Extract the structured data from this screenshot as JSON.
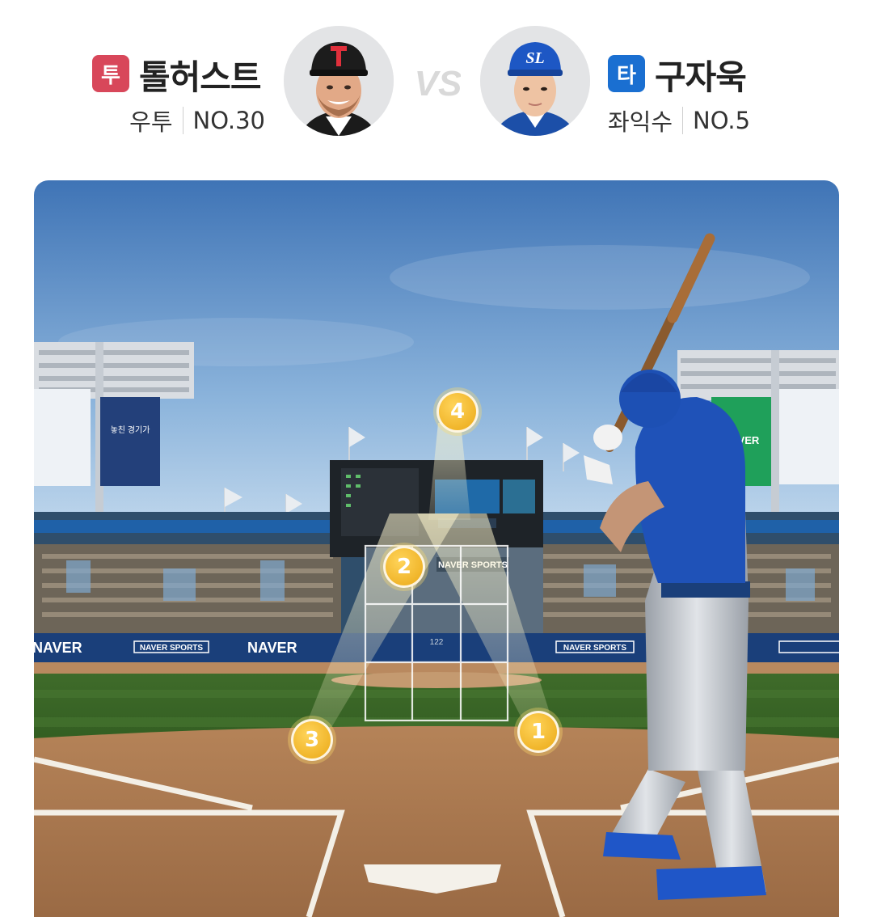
{
  "pitcher": {
    "role_badge": "투",
    "role_color": "#d8475a",
    "name": "톨허스트",
    "hand": "우투",
    "number": "NO.30",
    "avatar": "pitcher-headshot-icon"
  },
  "vs_label": "VS",
  "batter": {
    "role_badge": "타",
    "role_color": "#1a6fd1",
    "name": "구자욱",
    "hand": "좌익수",
    "number": "NO.5",
    "avatar": "batter-headshot-icon"
  },
  "field": {
    "scoreboard_pitch_count": "122",
    "ad_texts": [
      "NAVER",
      "NAVER SPORTS"
    ],
    "pitch_markers": [
      {
        "label": "1"
      },
      {
        "label": "2"
      },
      {
        "label": "3"
      },
      {
        "label": "4"
      }
    ]
  }
}
